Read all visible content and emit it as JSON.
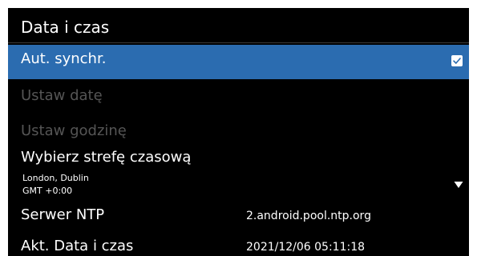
{
  "screen": {
    "title": "Data i czas"
  },
  "settings": {
    "auto_sync": {
      "label": "Aut. synchr.",
      "checked": true
    },
    "set_date": {
      "label": "Ustaw datę",
      "enabled": false
    },
    "set_time": {
      "label": "Ustaw godzinę",
      "enabled": false
    },
    "timezone": {
      "label": "Wybierz strefę czasową",
      "city": "London, Dublin",
      "offset": "GMT +0:00"
    },
    "ntp_server": {
      "label": "Serwer NTP",
      "value": "2.android.pool.ntp.org"
    },
    "current_datetime": {
      "label": "Akt. Data i czas",
      "value": "2021/12/06 05:11:18"
    }
  },
  "icons": {
    "checkbox": "checkbox-checked-icon",
    "dropdown": "chevron-down-icon"
  },
  "colors": {
    "background": "#000000",
    "highlight": "#2b6cb0",
    "text": "#ffffff",
    "disabled_text": "#555555"
  }
}
